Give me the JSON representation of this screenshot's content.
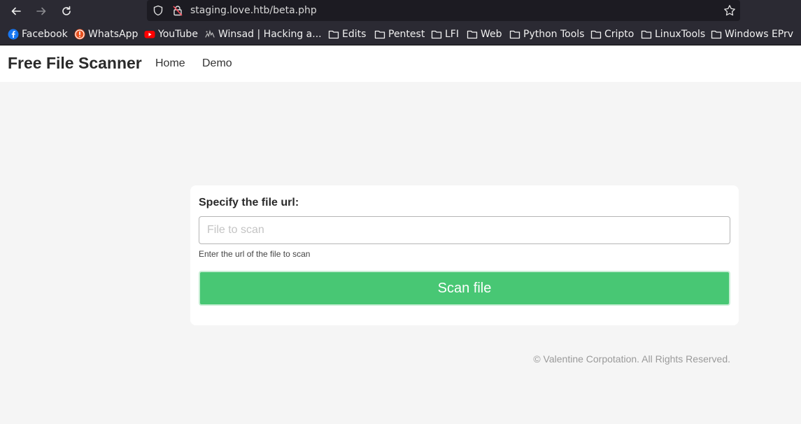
{
  "browser": {
    "url": "staging.love.htb/beta.php",
    "bookmarks": [
      {
        "label": "Facebook",
        "icon": "facebook-icon"
      },
      {
        "label": "WhatsApp",
        "icon": "whatsapp-icon"
      },
      {
        "label": "YouTube",
        "icon": "youtube-icon"
      },
      {
        "label": "Winsad | Hacking a...",
        "icon": "winsad-icon"
      },
      {
        "label": "Edits",
        "icon": "folder-icon"
      },
      {
        "label": "Pentest",
        "icon": "folder-icon"
      },
      {
        "label": "LFI",
        "icon": "folder-icon"
      },
      {
        "label": "Web",
        "icon": "folder-icon"
      },
      {
        "label": "Python Tools",
        "icon": "folder-icon"
      },
      {
        "label": "Cripto",
        "icon": "folder-icon"
      },
      {
        "label": "LinuxTools",
        "icon": "folder-icon"
      },
      {
        "label": "Windows EPrv",
        "icon": "folder-icon"
      }
    ]
  },
  "navbar": {
    "brand": "Free File Scanner",
    "links": [
      "Home",
      "Demo"
    ]
  },
  "form": {
    "label": "Specify the file url:",
    "input_value": "",
    "placeholder": "File to scan",
    "help": "Enter the url of the file to scan",
    "button": "Scan file"
  },
  "footer": {
    "text": "© Valentine Corpotation. All Rights Reserved."
  },
  "colors": {
    "chrome_bg": "#2b2a33",
    "urlbar_bg": "#1c1b22",
    "page_bg": "#f5f5f5",
    "button_green": "#48c774"
  }
}
